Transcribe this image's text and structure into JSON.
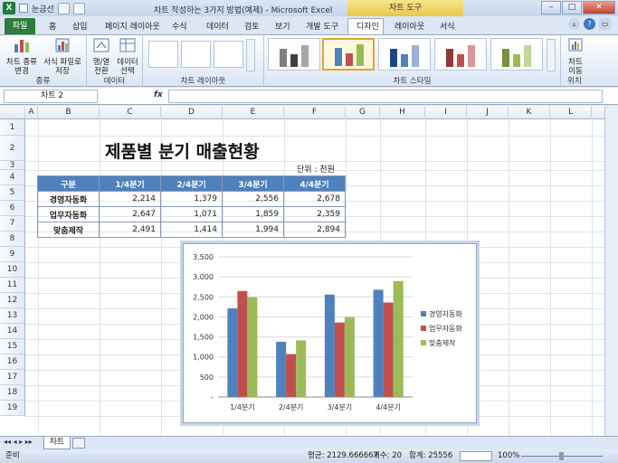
{
  "window": {
    "title": "차트 작성하는 3가지 방법(예제) - Microsoft Excel",
    "qat_label": "눈금선",
    "chart_tools": "차트 도구",
    "min": "–",
    "max": "□",
    "close": "✕"
  },
  "tabs": {
    "file": "파일",
    "home": "홈",
    "insert": "삽입",
    "page_layout": "페이지 레이아웃",
    "formulas": "수식",
    "data": "데이터",
    "review": "검토",
    "view": "보기",
    "developer": "개발 도구",
    "design": "디자인",
    "layout": "레이아웃",
    "format": "서식"
  },
  "ribbon": {
    "type_group": "종류",
    "change_type": "차트 종류\n변경",
    "save_template": "서식 파일로\n저장",
    "data_group": "데이터",
    "switch_rowcol": "행/열\n전환",
    "select_data": "데이터\n선택",
    "layouts_group": "차트 레이아웃",
    "styles_group": "차트 스타일",
    "location_group": "위치",
    "move_chart": "차트\n이동"
  },
  "formula": {
    "namebox": "차트 2",
    "fx": "fx",
    "value": ""
  },
  "columns": [
    "A",
    "B",
    "C",
    "D",
    "E",
    "F",
    "G",
    "H",
    "I",
    "J",
    "K",
    "L"
  ],
  "rows": [
    "1",
    "2",
    "3",
    "4",
    "5",
    "6",
    "7",
    "8",
    "9",
    "10",
    "11",
    "12",
    "13",
    "14",
    "15",
    "16",
    "17",
    "18",
    "19"
  ],
  "sheet": {
    "title": "제품별 분기 매출현황",
    "unit": "단위 : 천원",
    "headers": [
      "구분",
      "1/4분기",
      "2/4분기",
      "3/4분기",
      "4/4분기"
    ],
    "rows": [
      {
        "name": "경영자동화",
        "values": [
          "2,214",
          "1,379",
          "2,556",
          "2,678"
        ]
      },
      {
        "name": "업무자동화",
        "values": [
          "2,647",
          "1,071",
          "1,859",
          "2,359"
        ]
      },
      {
        "name": "맞춤제작",
        "values": [
          "2,491",
          "1,414",
          "1,994",
          "2,894"
        ]
      }
    ]
  },
  "chart_data": {
    "type": "bar",
    "categories": [
      "1/4분기",
      "2/4분기",
      "3/4분기",
      "4/4분기"
    ],
    "series": [
      {
        "name": "경영자동화",
        "values": [
          2214,
          1379,
          2556,
          2678
        ],
        "color": "#4f81bd"
      },
      {
        "name": "업무자동화",
        "values": [
          2647,
          1071,
          1859,
          2359
        ],
        "color": "#c0504d"
      },
      {
        "name": "맞춤제작",
        "values": [
          2491,
          1414,
          1994,
          2894
        ],
        "color": "#9bbb59"
      }
    ],
    "yticks": [
      "3,500",
      "3,000",
      "2,500",
      "2,000",
      "1,500",
      "1,000",
      "500",
      "-"
    ],
    "ylim": [
      0,
      3500
    ],
    "grid": true,
    "legend": "right"
  },
  "sheet_tabs": {
    "active": "차트"
  },
  "status": {
    "ready": "준비",
    "average": "평균: 2129.666667",
    "count": "개수: 20",
    "sum": "합계: 25556",
    "zoom": "100%"
  }
}
